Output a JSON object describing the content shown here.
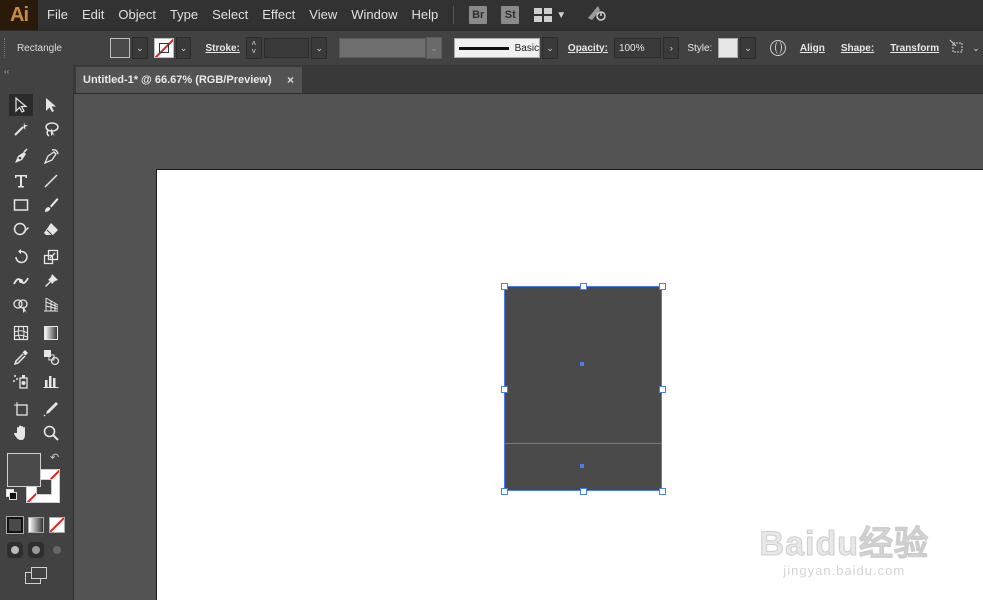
{
  "app": {
    "logo_text": "Ai",
    "menus": [
      "File",
      "Edit",
      "Object",
      "Type",
      "Select",
      "Effect",
      "View",
      "Window",
      "Help"
    ],
    "bridge_label": "Br",
    "stock_label": "St"
  },
  "control_bar": {
    "tool_name": "Rectangle",
    "stroke_label": "Stroke:",
    "stroke_value": "",
    "brush_label": "Basic",
    "opacity_label": "Opacity:",
    "opacity_value": "100%",
    "style_label": "Style:",
    "align_label": "Align",
    "shape_label": "Shape:",
    "transform_label": "Transform"
  },
  "document": {
    "tab_title": "Untitled-1* @ 66.67% (RGB/Preview)",
    "close_glyph": "×"
  },
  "colors": {
    "fill": "#4a4a4a",
    "stroke": "none",
    "selection": "#4a7ef0",
    "ui_bg": "#535353"
  },
  "watermark": {
    "brand": "Baidu经验",
    "url": "jingyan.baidu.com"
  }
}
